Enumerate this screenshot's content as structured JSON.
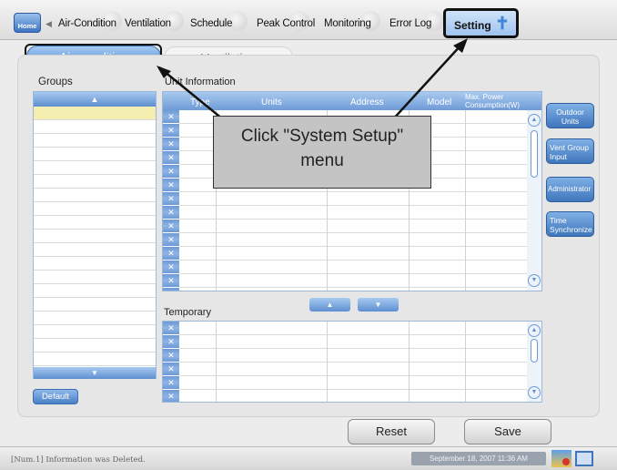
{
  "nav": {
    "home": "Home",
    "tabs": [
      "Air-Condition",
      "Ventilation",
      "Schedule",
      "Peak Control",
      "Monitoring",
      "Error Log",
      "Setting"
    ]
  },
  "subtabs": {
    "air": "Air–condition",
    "vent": "Ventilation"
  },
  "groups": {
    "title": "Groups",
    "default": "Default"
  },
  "unit_info": {
    "title": "Unit Information",
    "columns": [
      "Type",
      "Units",
      "Address",
      "Model",
      "Max. Power Consumption(W)"
    ]
  },
  "temporary": {
    "title": "Temporary"
  },
  "side_buttons": [
    "Outdoor Units",
    "Vent Group Input",
    "Administrator",
    "Time Synchronize"
  ],
  "actions": {
    "reset": "Reset",
    "save": "Save"
  },
  "status": {
    "message": "[Num.1] Information was Deleted.",
    "datetime": "September 18, 2007 11:36 AM"
  },
  "callout": {
    "text": "Click \"System Setup\" menu"
  },
  "colors": {
    "accent_blue": "#3f76bb",
    "selected_row": "#f4efb0",
    "arrow_blue": "#5f8fd0"
  }
}
